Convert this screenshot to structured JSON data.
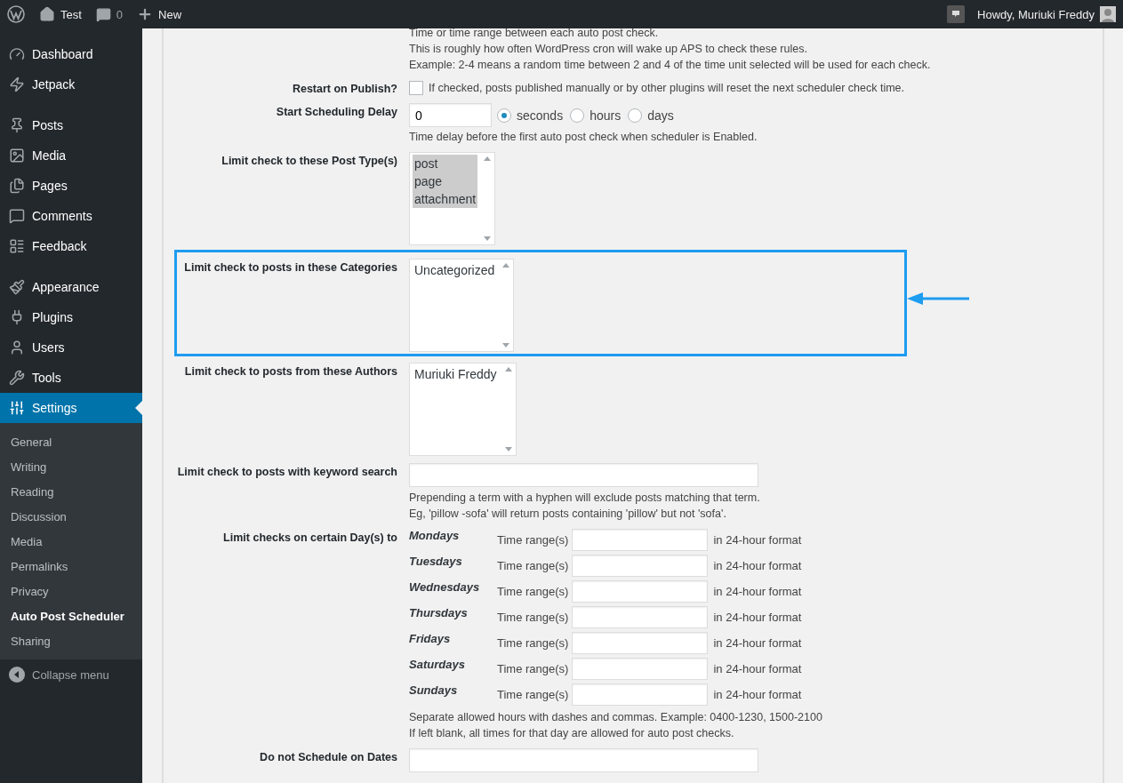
{
  "admin_bar": {
    "site": "Test",
    "comments": "0",
    "new": "New",
    "greeting": "Howdy, Muriuki Freddy"
  },
  "sidebar": {
    "groups": [
      [
        {
          "label": "Dashboard",
          "selected": false
        },
        {
          "label": "Jetpack",
          "selected": false
        }
      ],
      [
        {
          "label": "Posts",
          "selected": false
        },
        {
          "label": "Media",
          "selected": false
        },
        {
          "label": "Pages",
          "selected": false
        },
        {
          "label": "Comments",
          "selected": false
        },
        {
          "label": "Feedback",
          "selected": false
        }
      ],
      [
        {
          "label": "Appearance",
          "selected": false
        },
        {
          "label": "Plugins",
          "selected": false
        },
        {
          "label": "Users",
          "selected": false
        },
        {
          "label": "Tools",
          "selected": false
        },
        {
          "label": "Settings",
          "selected": true
        }
      ]
    ],
    "submenu": [
      {
        "label": "General",
        "selected": false
      },
      {
        "label": "Writing",
        "selected": false
      },
      {
        "label": "Reading",
        "selected": false
      },
      {
        "label": "Discussion",
        "selected": false
      },
      {
        "label": "Media",
        "selected": false
      },
      {
        "label": "Permalinks",
        "selected": false
      },
      {
        "label": "Privacy",
        "selected": false
      },
      {
        "label": "Auto Post Scheduler",
        "selected": true
      },
      {
        "label": "Sharing",
        "selected": false
      }
    ],
    "collapse": "Collapse menu"
  },
  "form": {
    "rows": [
      {
        "kind": "notes",
        "lines": [
          "Time or time range between each auto post check.",
          "This is roughly how often WordPress cron will wake up APS to check these rules.",
          "Example: 2-4 means a random time between 2 and 4 of the time unit selected will be used for each check."
        ]
      },
      {
        "kind": "checkbox",
        "label": "Restart on Publish?",
        "checked": false,
        "text": "If checked, posts published manually or by other plugins will reset the next scheduler check time."
      },
      {
        "kind": "delay",
        "label": "Start Scheduling Delay",
        "value": "0",
        "units": [
          {
            "label": "seconds",
            "selected": true
          },
          {
            "label": "hours",
            "selected": false
          },
          {
            "label": "days",
            "selected": false
          }
        ],
        "note": "Time delay before the first auto post check when scheduler is Enabled."
      },
      {
        "kind": "multiselect",
        "label": "Limit check to these Post Type(s)",
        "highlighted": false,
        "options": [
          {
            "label": "post",
            "selected": true
          },
          {
            "label": "page",
            "selected": true
          },
          {
            "label": "attachment",
            "selected": true
          }
        ]
      },
      {
        "kind": "multiselect",
        "label": "Limit check to posts in these Categories",
        "highlighted": true,
        "options": [
          {
            "label": "Uncategorized",
            "selected": false
          }
        ]
      },
      {
        "kind": "multiselect",
        "label": "Limit check to posts from these Authors",
        "highlighted": false,
        "options": [
          {
            "label": "Muriuki Freddy",
            "selected": false
          }
        ]
      },
      {
        "kind": "text",
        "label": "Limit check to posts with keyword search",
        "notes": [
          "Prepending a term with a hyphen will exclude posts matching that term.",
          "Eg, 'pillow -sofa' will return posts containing 'pillow' but not 'sofa'."
        ]
      },
      {
        "kind": "days",
        "label": "Limit checks on certain Day(s) to",
        "days": [
          {
            "day": "Mondays",
            "range_label": "Time range(s)",
            "suffix": "in 24-hour format"
          },
          {
            "day": "Tuesdays",
            "range_label": "Time range(s)",
            "suffix": "in 24-hour format"
          },
          {
            "day": "Wednesdays",
            "range_label": "Time range(s)",
            "suffix": "in 24-hour format"
          },
          {
            "day": "Thursdays",
            "range_label": "Time range(s)",
            "suffix": "in 24-hour format"
          },
          {
            "day": "Fridays",
            "range_label": "Time range(s)",
            "suffix": "in 24-hour format"
          },
          {
            "day": "Saturdays",
            "range_label": "Time range(s)",
            "suffix": "in 24-hour format"
          },
          {
            "day": "Sundays",
            "range_label": "Time range(s)",
            "suffix": "in 24-hour format"
          }
        ],
        "notes": [
          "Separate allowed hours with dashes and commas. Example: 0400-1230, 1500-2100",
          "If left blank, all times for that day are allowed for auto post checks."
        ]
      },
      {
        "kind": "text",
        "label": "Do not Schedule on Dates"
      }
    ]
  }
}
